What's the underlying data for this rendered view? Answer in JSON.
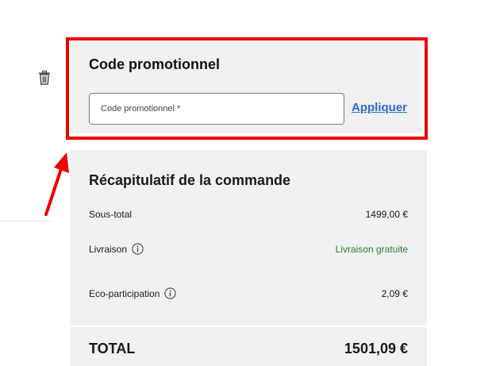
{
  "promo": {
    "title": "Code promotionnel",
    "input_placeholder": "Code promotionnel *",
    "input_value": "",
    "apply_label": "Appliquer"
  },
  "summary": {
    "title": "Récapitulatif de la commande",
    "subtotal_label": "Sous-total",
    "subtotal_value": "1499,00 €",
    "delivery_label": "Livraison",
    "delivery_value": "Livraison gratuite",
    "eco_label": "Eco-participation",
    "eco_value": "2,09 €",
    "total_label": "TOTAL",
    "total_value": "1501,09 €"
  },
  "icons": {
    "trash": "trash-icon",
    "info": "info-icon"
  },
  "colors": {
    "highlight": "#ee0000",
    "link": "#2a6bd1",
    "free_delivery": "#2e7d32",
    "panel_bg": "#f1f1f1"
  }
}
